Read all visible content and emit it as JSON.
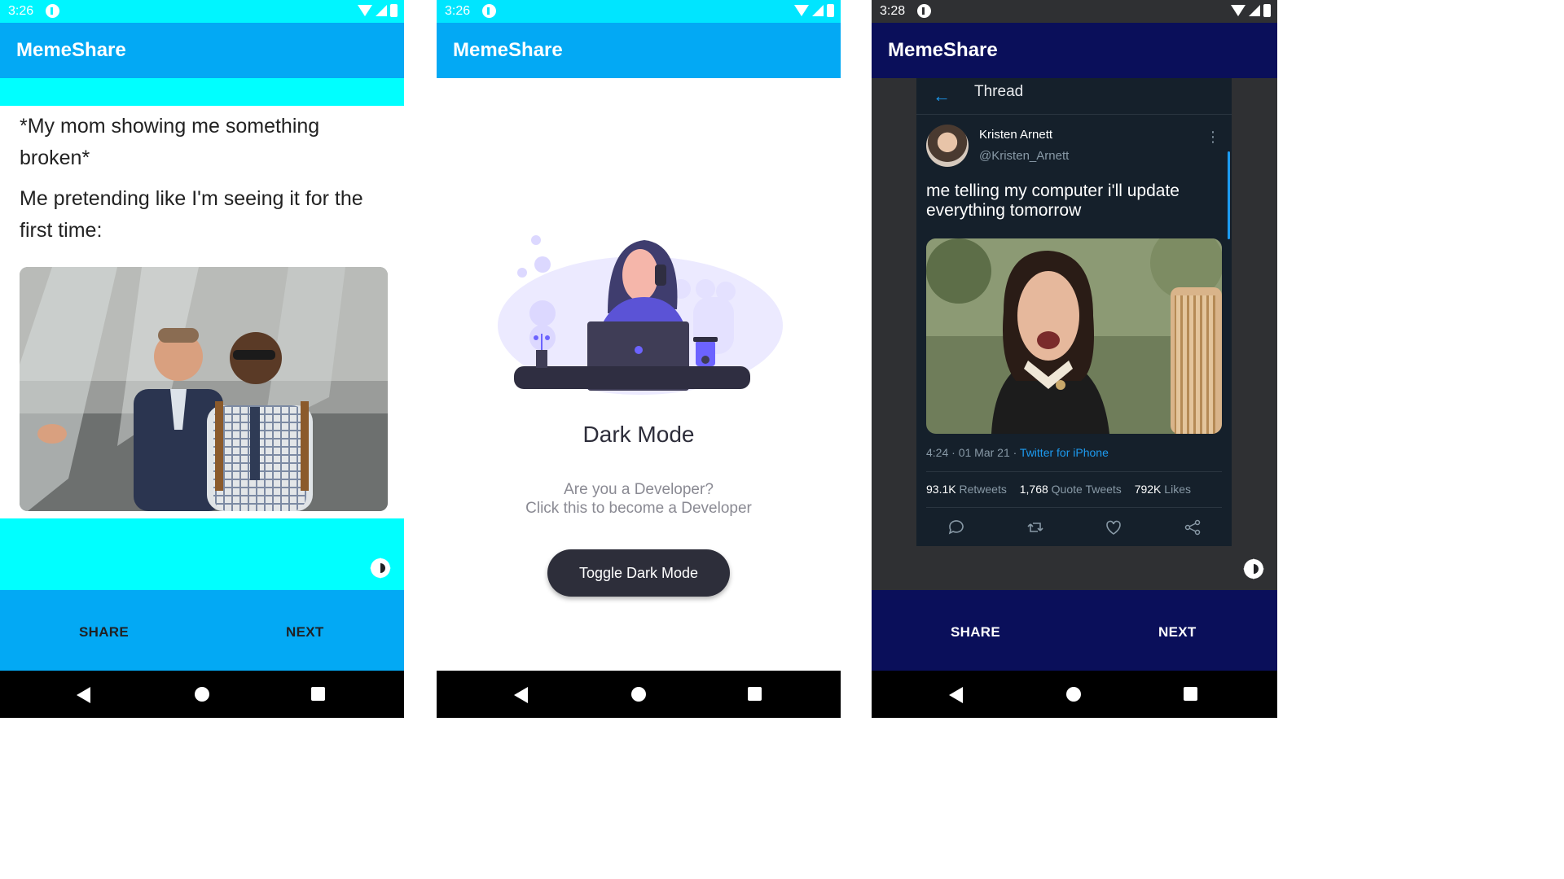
{
  "phones": [
    {
      "status_time": "3:26",
      "app_title": "MemeShare",
      "meme": {
        "caption_line1": "*My mom showing me something broken*",
        "caption_line2": "Me pretending like I'm seeing it for the first time:"
      },
      "buttons": {
        "share": "SHARE",
        "next": "NEXT"
      },
      "icons": {
        "theme_toggle": "brightness-icon"
      },
      "colors": {
        "statusbar": "#00f5ff",
        "appbar": "#03a9f4",
        "accent_strip": "#00ffff"
      }
    },
    {
      "status_time": "3:26",
      "app_title": "MemeShare",
      "dark_mode": {
        "title": "Dark Mode",
        "subtitle_line1": "Are you a Developer?",
        "subtitle_line2": "Click this to become a Developer",
        "button": "Toggle Dark Mode"
      }
    },
    {
      "status_time": "3:28",
      "app_title": "MemeShare",
      "tweet": {
        "header": "Thread",
        "author": "Kristen Arnett",
        "handle": "@Kristen_Arnett",
        "text": "me telling my computer i'll update everything tomorrow",
        "time": "4:24 · 01 Mar 21 · ",
        "source": "Twitter for iPhone",
        "retweets": "93.1K",
        "retweets_label": "Retweets",
        "quote_tweets": "1,768",
        "quote_tweets_label": "Quote Tweets",
        "likes": "792K",
        "likes_label": "Likes"
      },
      "buttons": {
        "share": "SHARE",
        "next": "NEXT"
      },
      "colors": {
        "appbar": "#0a0f5a",
        "tweet_bg": "#15202b",
        "link": "#1d9bf0"
      }
    }
  ]
}
